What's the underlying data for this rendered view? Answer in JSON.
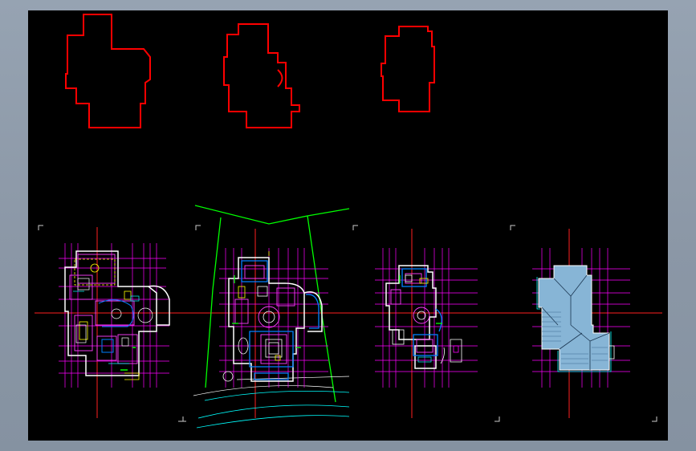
{
  "app": {
    "title": "",
    "background": "#000000",
    "colors": {
      "outline": "#ff0000",
      "axis": "#ff2020",
      "grid": "#ff00ff",
      "site": "#00ff00",
      "wall": "#ffffff",
      "interior": "#ff40ff",
      "frame": "#0080ff",
      "furniture": "#ffff00",
      "annotation": "#00ffff",
      "roof": "#87b5d6"
    }
  },
  "drawing": {
    "footprints": [
      {
        "name": "footprint-outline-1"
      },
      {
        "name": "footprint-outline-2"
      },
      {
        "name": "footprint-outline-3"
      }
    ],
    "sheets": [
      {
        "name": "ground-floor-plan"
      },
      {
        "name": "first-floor-plan-with-site"
      },
      {
        "name": "second-floor-plan"
      },
      {
        "name": "roof-plan"
      }
    ]
  }
}
